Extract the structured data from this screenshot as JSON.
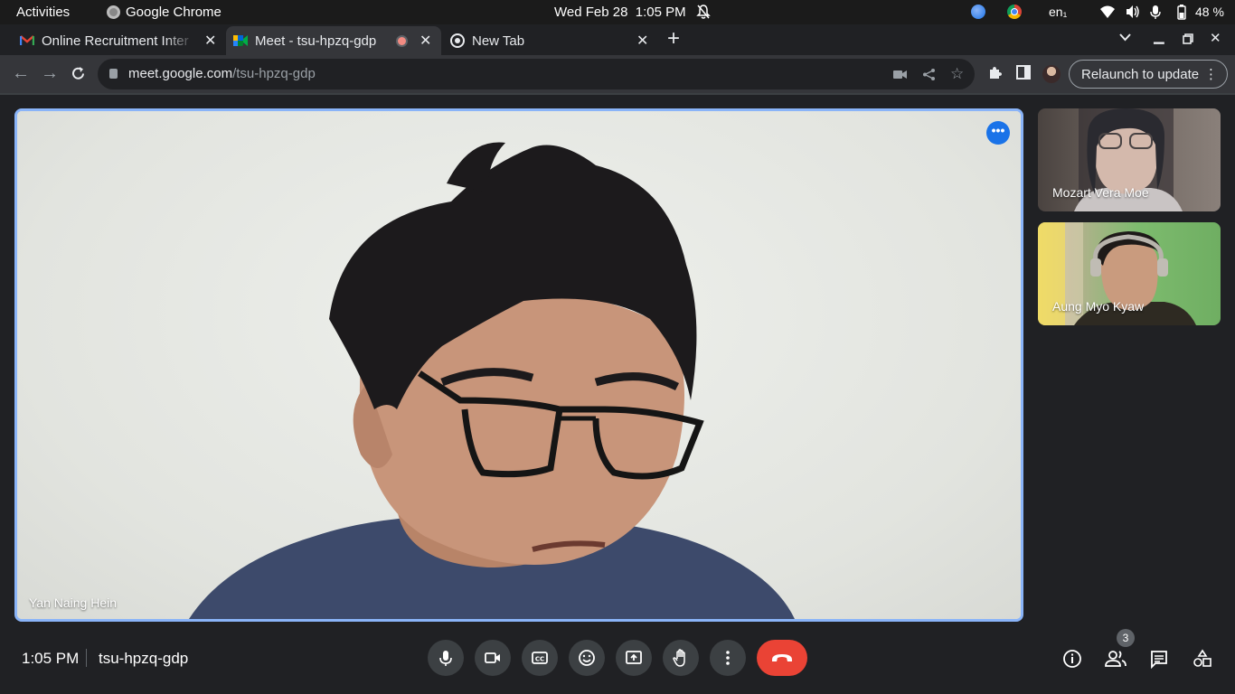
{
  "os_bar": {
    "activities": "Activities",
    "app_name": "Google Chrome",
    "clock": "Wed Feb 28  1:05 PM",
    "language": "en₁",
    "battery": "48 %"
  },
  "tabs": [
    {
      "title": "Online Recruitment Inter",
      "favicon": "gmail-icon",
      "active": false
    },
    {
      "title": "Meet - tsu-hpzq-gdp",
      "favicon": "meet-icon",
      "active": true,
      "recording": true
    },
    {
      "title": "New Tab",
      "favicon": "chrome-icon",
      "active": false
    }
  ],
  "toolbar": {
    "url_host": "meet.google.com",
    "url_path": "/tsu-hpzq-gdp",
    "relaunch_label": "Relaunch to update"
  },
  "meeting": {
    "time": "1:05 PM",
    "code": "tsu-hpzq-gdp",
    "participant_count": "3",
    "accent": "#8ab4f8",
    "hangup_color": "#ea4335"
  },
  "participants": [
    {
      "name": "Yan Naing Hein",
      "tile": "main"
    },
    {
      "name": "Mozart Vera Moe",
      "tile": "side"
    },
    {
      "name": "Aung Myo Kyaw",
      "tile": "side"
    }
  ]
}
